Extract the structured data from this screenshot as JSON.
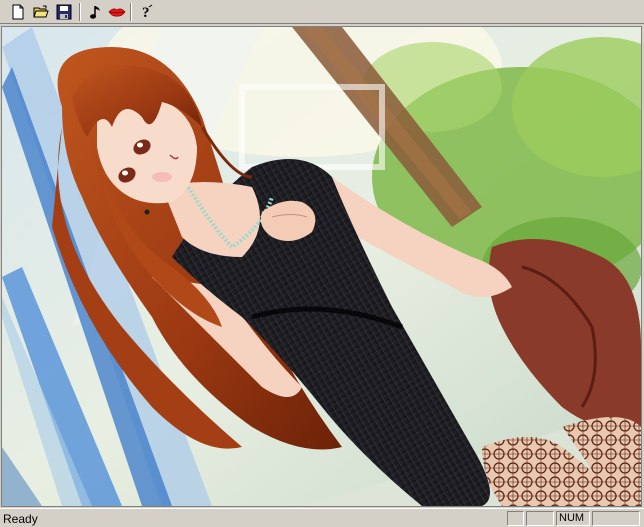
{
  "toolbar": {
    "buttons": [
      {
        "name": "new-document-icon"
      },
      {
        "name": "open-folder-icon"
      },
      {
        "name": "save-disk-icon"
      },
      {
        "name": "music-note-icon"
      },
      {
        "name": "lips-icon"
      },
      {
        "name": "help-question-icon"
      }
    ]
  },
  "status": {
    "text": "Ready",
    "panes": [
      "",
      "",
      "NUM",
      ""
    ]
  },
  "colors": {
    "chrome": "#d4d0c8",
    "hair": "#a8441c",
    "dress": "#1c1c20",
    "skin": "#f6d3c0",
    "foliage": "#7fb84a"
  }
}
